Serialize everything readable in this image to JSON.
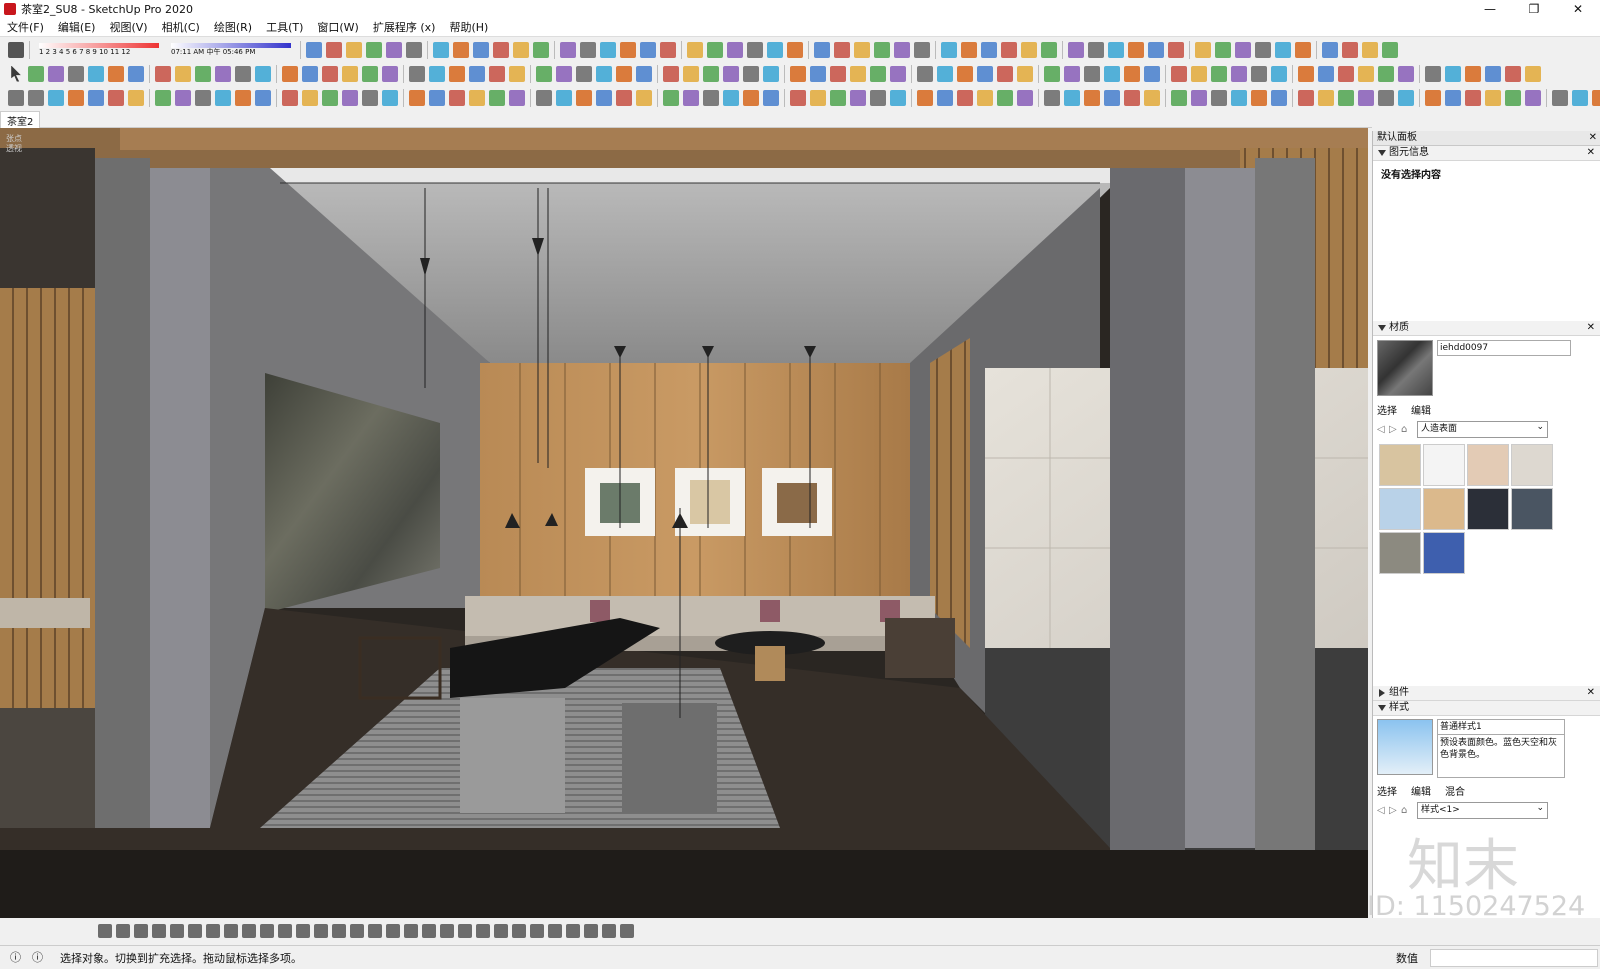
{
  "window": {
    "title": "茶室2_SU8 - SketchUp Pro 2020",
    "minimize": "—",
    "maximize": "❐",
    "close": "✕"
  },
  "menu": [
    "文件(F)",
    "编辑(E)",
    "视图(V)",
    "相机(C)",
    "绘图(R)",
    "工具(T)",
    "窗口(W)",
    "扩展程序 (x)",
    "帮助(H)"
  ],
  "shadow": {
    "months": "1 2 3 4 5 6 7 8 9 10 11 12",
    "time_start": "07:11 AM",
    "noon": "中午",
    "time_end": "05:46 PM"
  },
  "tab": "茶室2",
  "camera_label": [
    "张点",
    "透视"
  ],
  "panel": {
    "title": "默认面板",
    "entity_info": {
      "heading": "图元信息",
      "text": "没有选择内容"
    },
    "materials": {
      "heading": "材质",
      "name": "iehdd0097",
      "tabs": [
        "选择",
        "编辑"
      ],
      "library": "人造表面",
      "swatches": [
        "#d8c4a0",
        "#f4f4f4",
        "#e3cbb5",
        "#ddd8d0",
        "#b9d2e8",
        "#dbb98c",
        "#2b2f38",
        "#4a5562",
        "#8c8a80",
        "#3e5fae"
      ]
    },
    "components": {
      "heading": "组件"
    },
    "styles": {
      "heading": "样式",
      "name": "普通样式1",
      "description": "预设表面颜色。蓝色天空和灰色背景色。",
      "tabs": [
        "选择",
        "编辑",
        "混合"
      ],
      "collection": "样式<1>"
    }
  },
  "watermarks": {
    "logo": "知末",
    "id": "ID: 1150247524"
  },
  "status": {
    "hint": "选择对象。切换到扩充选择。拖动鼠标选择多项。",
    "measurement_label": "数值"
  },
  "colors": {
    "accent": "#c8161d",
    "toolbar": "#f0f0f0"
  }
}
